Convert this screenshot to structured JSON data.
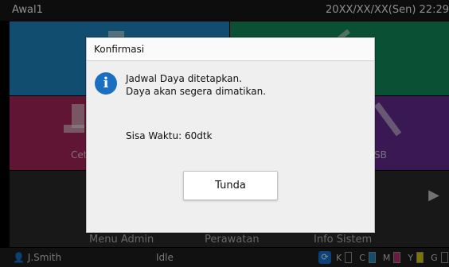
{
  "app": {
    "title": "Awal1",
    "clock": "20XX/XX/XX(Sen) 22:29"
  },
  "tiles": {
    "red_label": "Cet",
    "purple_label": "SB"
  },
  "menu": {
    "admin": "Menu Admin",
    "maintenance": "Perawatan",
    "system_info": "Info Sistem"
  },
  "status": {
    "user": "J.Smith",
    "state": "Idle",
    "toner": {
      "k_label": "K",
      "c_label": "C",
      "m_label": "M",
      "y_label": "Y",
      "g_label": "G",
      "c_color": "#1e8dc8",
      "m_color": "#c0307a",
      "y_color": "#e6d400"
    }
  },
  "dialog": {
    "title": "Konfirmasi",
    "message_line1": "Jadwal Daya ditetapkan.",
    "message_line2": "Daya akan segera dimatikan.",
    "remaining": "Sisa Waktu: 60dtk",
    "button_label": "Tunda"
  },
  "icons": {
    "info": "info-icon",
    "user": "user-icon",
    "next": "chevron-right-icon"
  }
}
